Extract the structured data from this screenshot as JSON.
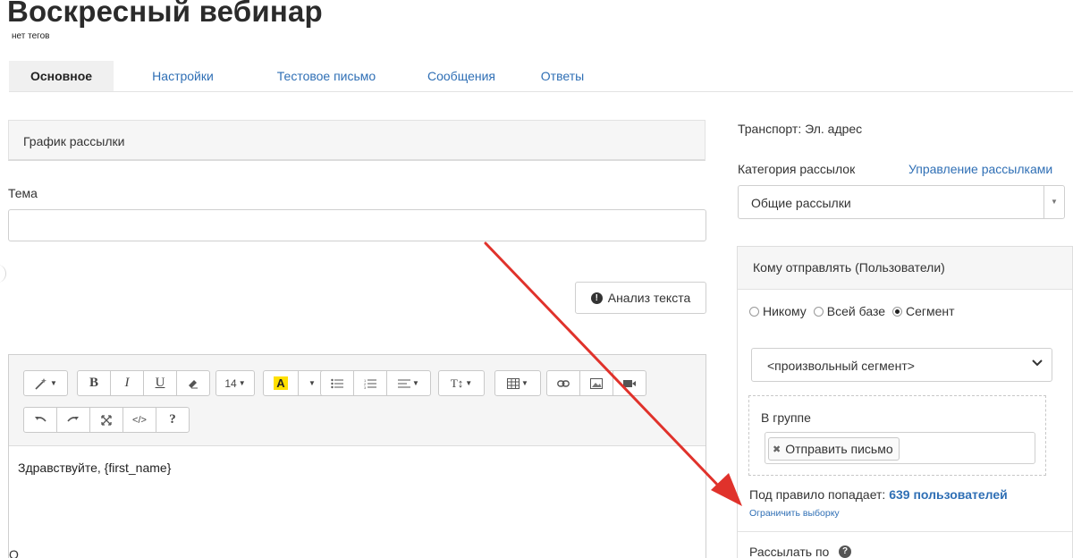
{
  "page": {
    "title": "Воскресный вебинар",
    "tags_text": "нет тегов"
  },
  "tabs": [
    {
      "label": "Основное",
      "active": true
    },
    {
      "label": "Настройки",
      "active": false
    },
    {
      "label": "Тестовое письмо",
      "active": false
    },
    {
      "label": "Сообщения",
      "active": false
    },
    {
      "label": "Ответы",
      "active": false
    }
  ],
  "left": {
    "schedule_title": "График рассылки",
    "subject_label": "Тема",
    "subject_value": "",
    "analyze_button": "Анализ текста",
    "analyze_icon": "info-circle",
    "editor": {
      "font_size": "14",
      "body_text": "Здравствуйте, {first_name}",
      "toolbar_row1": [
        "magic-wand-icon",
        "bold-icon",
        "italic-icon",
        "underline-icon",
        "eraser-icon",
        "font-size-dropdown",
        "text-color-icon",
        "unordered-list-icon",
        "ordered-list-icon",
        "align-icon",
        "line-height-icon",
        "table-icon",
        "link-icon",
        "image-icon",
        "video-icon"
      ],
      "toolbar_row2": [
        "undo-icon",
        "redo-icon",
        "fullscreen-icon",
        "code-view-icon",
        "help-icon"
      ],
      "help_label": "?",
      "code_label": "</>"
    },
    "bottom_cut_text": "О"
  },
  "right": {
    "transport": "Транспорт: Эл. адрес",
    "category_label": "Категория рассылок",
    "manage_link": "Управление рассылками",
    "category_value": "Общие рассылки",
    "recipients": {
      "title": "Кому отправлять (Пользователи)",
      "options": [
        {
          "label": "Никому",
          "checked": false
        },
        {
          "label": "Всей базе",
          "checked": false
        },
        {
          "label": "Сегмент",
          "checked": true
        }
      ],
      "segment_value": "<произвольный сегмент>",
      "group_label": "В группе",
      "group_tag": "Отправить письмо",
      "rule_prefix": "Под правило попадает:",
      "rule_count": "639 пользователей",
      "limit_link": "Ограничить выборку",
      "send_by_label": "Рассылать по"
    }
  },
  "colors": {
    "link": "#2f6fb5",
    "arrow": "#e0322b",
    "highlight": "#ffe000"
  }
}
